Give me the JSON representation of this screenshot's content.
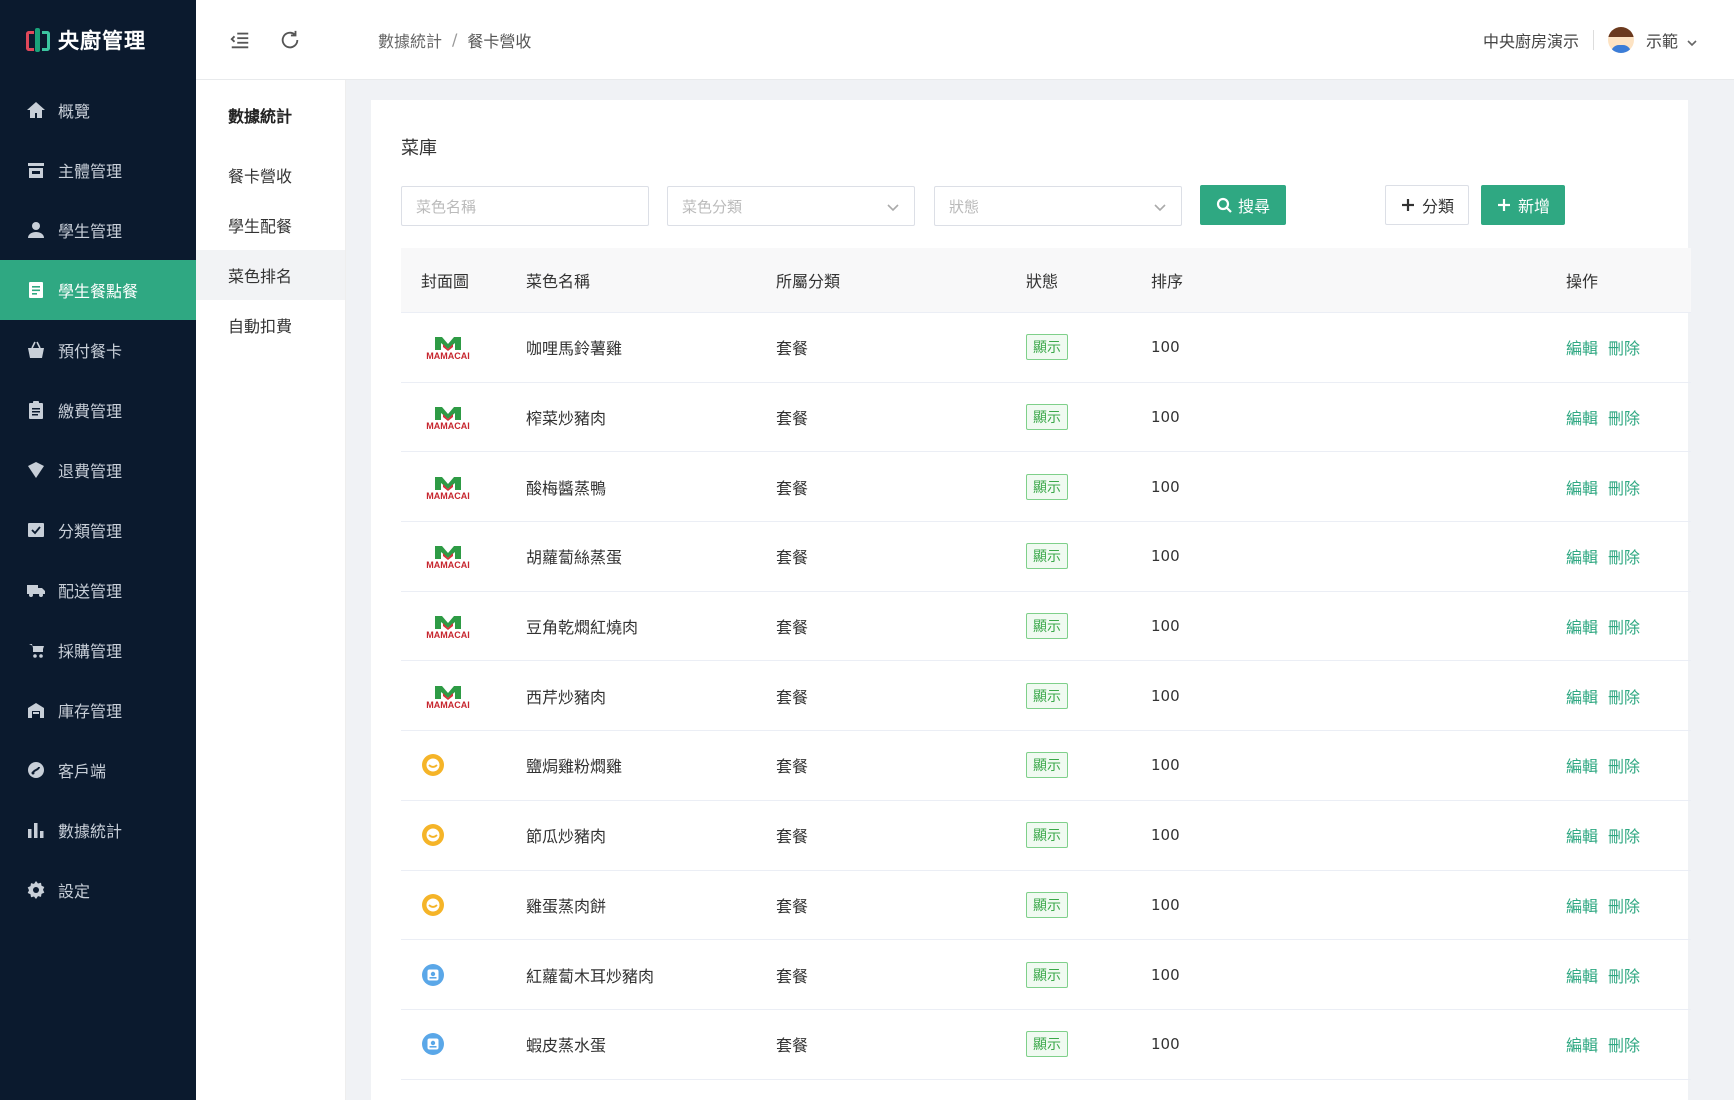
{
  "app": {
    "title": "央廚管理"
  },
  "sidebar": {
    "items": [
      {
        "label": "概覽",
        "icon": "home-icon"
      },
      {
        "label": "主體管理",
        "icon": "store-icon"
      },
      {
        "label": "學生管理",
        "icon": "user-icon"
      },
      {
        "label": "學生餐點餐",
        "icon": "document-icon",
        "active": true
      },
      {
        "label": "預付餐卡",
        "icon": "basket-icon"
      },
      {
        "label": "繳費管理",
        "icon": "clipboard-icon"
      },
      {
        "label": "退費管理",
        "icon": "refund-icon"
      },
      {
        "label": "分類管理",
        "icon": "category-icon"
      },
      {
        "label": "配送管理",
        "icon": "truck-icon"
      },
      {
        "label": "採購管理",
        "icon": "cart-icon"
      },
      {
        "label": "庫存管理",
        "icon": "warehouse-icon"
      },
      {
        "label": "客戶端",
        "icon": "client-icon"
      },
      {
        "label": "數據統計",
        "icon": "bar-chart-icon"
      },
      {
        "label": "設定",
        "icon": "gear-icon"
      }
    ]
  },
  "header": {
    "breadcrumb": [
      "數據統計",
      "餐卡營收"
    ],
    "org": "中央廚房演示",
    "user": "示範"
  },
  "submenu": {
    "title": "數據統計",
    "items": [
      {
        "label": "餐卡營收"
      },
      {
        "label": "學生配餐"
      },
      {
        "label": "菜色排名",
        "active": true
      },
      {
        "label": "自動扣費"
      }
    ]
  },
  "main": {
    "title": "菜庫",
    "filters": {
      "name_placeholder": "菜色名稱",
      "category_placeholder": "菜色分類",
      "status_placeholder": "狀態",
      "search_label": "搜尋",
      "category_button": "分類",
      "add_button": "新增"
    },
    "table": {
      "headers": [
        "封面圖",
        "菜色名稱",
        "所屬分類",
        "狀態",
        "排序",
        "操作"
      ],
      "edit_label": "編輯",
      "delete_label": "刪除",
      "rows": [
        {
          "cover": "mamacai",
          "cover_text": "MAMACAI",
          "name": "咖哩馬鈴薯雞",
          "category": "套餐",
          "status": "顯示",
          "sort": "100"
        },
        {
          "cover": "mamacai",
          "cover_text": "MAMACAI",
          "name": "榨菜炒豬肉",
          "category": "套餐",
          "status": "顯示",
          "sort": "100"
        },
        {
          "cover": "mamacai",
          "cover_text": "MAMACAI",
          "name": "酸梅醬蒸鴨",
          "category": "套餐",
          "status": "顯示",
          "sort": "100"
        },
        {
          "cover": "mamacai",
          "cover_text": "MAMACAI",
          "name": "胡蘿蔔絲蒸蛋",
          "category": "套餐",
          "status": "顯示",
          "sort": "100"
        },
        {
          "cover": "mamacai",
          "cover_text": "MAMACAI",
          "name": "豆角乾燜紅燒肉",
          "category": "套餐",
          "status": "顯示",
          "sort": "100"
        },
        {
          "cover": "mamacai",
          "cover_text": "MAMACAI",
          "name": "西芹炒豬肉",
          "category": "套餐",
          "status": "顯示",
          "sort": "100"
        },
        {
          "cover": "yellow",
          "name": "鹽焗雞粉燜雞",
          "category": "套餐",
          "status": "顯示",
          "sort": "100"
        },
        {
          "cover": "yellow",
          "name": "節瓜炒豬肉",
          "category": "套餐",
          "status": "顯示",
          "sort": "100"
        },
        {
          "cover": "yellow",
          "name": "雞蛋蒸肉餅",
          "category": "套餐",
          "status": "顯示",
          "sort": "100"
        },
        {
          "cover": "blue",
          "name": "紅蘿蔔木耳炒豬肉",
          "category": "套餐",
          "status": "顯示",
          "sort": "100"
        },
        {
          "cover": "blue",
          "name": "蝦皮蒸水蛋",
          "category": "套餐",
          "status": "顯示",
          "sort": "100"
        }
      ]
    }
  },
  "colors": {
    "accent": "#2fa882",
    "sidebar": "#0b1a2e",
    "badge_green": "#3ba84a"
  }
}
